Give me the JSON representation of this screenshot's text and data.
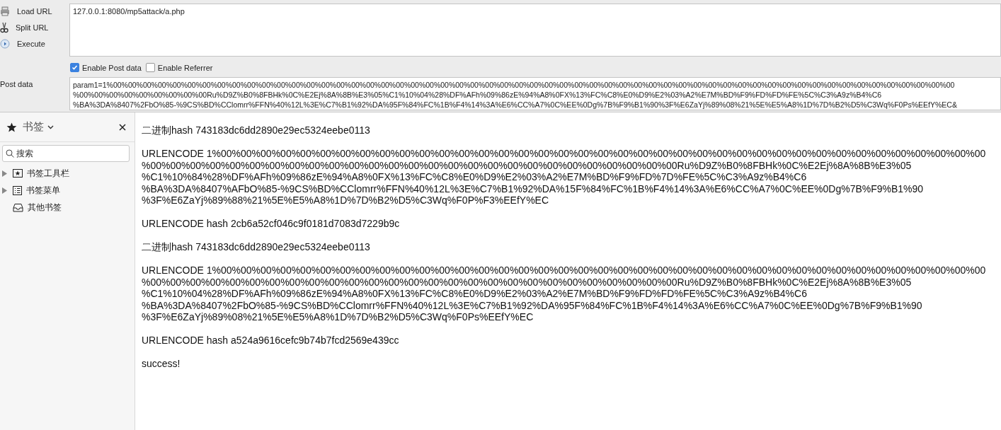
{
  "toolbar": {
    "buttons": [
      {
        "label": "Load URL",
        "kind": "load"
      },
      {
        "label": "Split URL",
        "kind": "split"
      },
      {
        "label": "Execute",
        "kind": "execute"
      }
    ],
    "url": "127.0.0.1:8080/mp5attack/a.php",
    "options": [
      {
        "label": "Enable Post data",
        "checked": true
      },
      {
        "label": "Enable Referrer",
        "checked": false
      }
    ],
    "post_data": {
      "label": "Post data",
      "lines": [
        "param1=1%00%00%00%00%00%00%00%00%00%00%00%00%00%00%00%00%00%00%00%00%00%00%00%00%00%00%00%00%00%00%00%00%00%00%00%00%00%00%00%00%00%00%00%00%00%00%00%00%00%00%00%00%00%00%00%00%00",
        "%00%00%00%00%00%00%00%00%00Ru%D9Z%B0%8FBHk%0C%E2Ej%8A%8B%E3%05%C1%10%04%28%DF%AFh%09%86zE%94%A8%0FX%13%FC%C8%E0%D9%E2%03%A2%E7M%BD%F9%FD%FD%FE%5C%C3%A9z%B4%C6",
        "%BA%3DA%8407%2FbO%85-%9CS%BD%CClomrr%FFN%40%12L%3E%C7%B1%92%DA%95F%84%FC%1B%F4%14%3A%E6%CC%A7%0C%EE%0Dg%7B%F9%B1%90%3F%E6ZaYj%89%08%21%5E%E5%A8%1D%7D%B2%D5%C3Wq%F0Ps%EEfY%EC&"
      ]
    }
  },
  "sidebar": {
    "title": "书签",
    "search": {
      "placeholder": "搜索"
    },
    "items": [
      {
        "label": "书签工具栏",
        "kind": "toolbar",
        "expandable": true
      },
      {
        "label": "书签菜单",
        "kind": "menu",
        "expandable": true
      },
      {
        "label": "其他书签",
        "kind": "other",
        "expandable": false
      }
    ]
  },
  "output": [
    {
      "kind": "text",
      "text": "二进制hash 743183dc6dd2890e29ec5324eebe0113"
    },
    {
      "kind": "block",
      "lines": [
        "URLENCODE 1%00%00%00%00%00%00%00%00%00%00%00%00%00%00%00%00%00%00%00%00%00%00%00%00%00%00%00%00%00%00%00%00%00%00%00%00%00%00%00",
        "%00%00%00%00%00%00%00%00%00%00%00%00%00%00%00%00%00%00%00%00%00%00%00%00%00%00%00Ru%D9Z%B0%8FBHk%0C%E2Ej%8A%8B%E3%05",
        "%C1%10%84%28%DF%AFh%09%86zE%94%A8%0FX%13%FC%C8%E0%D9%E2%03%A2%E7M%BD%F9%FD%7D%FE%5C%C3%A9z%B4%C6",
        "%BA%3DA%8407%AFbO%85-%9CS%BD%CClomrr%FFN%40%12L%3E%C7%B1%92%DA%15F%84%FC%1B%F4%14%3A%E6%CC%A7%0C%EE%0Dg%7B%F9%B1%90",
        "%3F%E6ZaYj%89%88%21%5E%E5%A8%1D%7D%B2%D5%C3Wq%F0P%F3%EEfY%EC"
      ]
    },
    {
      "kind": "text",
      "text": "URLENCODE hash 2cb6a52cf046c9f0181d7083d7229b9c"
    },
    {
      "kind": "text",
      "text": "二进制hash 743183dc6dd2890e29ec5324eebe0113"
    },
    {
      "kind": "block",
      "lines": [
        "URLENCODE 1%00%00%00%00%00%00%00%00%00%00%00%00%00%00%00%00%00%00%00%00%00%00%00%00%00%00%00%00%00%00%00%00%00%00%00%00%00%00%00",
        "%00%00%00%00%00%00%00%00%00%00%00%00%00%00%00%00%00%00%00%00%00%00%00%00%00%00%00Ru%D9Z%B0%8FBHk%0C%E2Ej%8A%8B%E3%05",
        "%C1%10%04%28%DF%AFh%09%86zE%94%A8%0FX%13%FC%C8%E0%D9%E2%03%A2%E7M%BD%F9%FD%FD%FE%5C%C3%A9z%B4%C6",
        "%BA%3DA%8407%2FbO%85-%9CS%BD%CClomrr%FFN%40%12L%3E%C7%B1%92%DA%95F%84%FC%1B%F4%14%3A%E6%CC%A7%0C%EE%0Dg%7B%F9%B1%90",
        "%3F%E6ZaYj%89%08%21%5E%E5%A8%1D%7D%B2%D5%C3Wq%F0Ps%EEfY%EC"
      ]
    },
    {
      "kind": "text",
      "text": "URLENCODE hash a524a9616cefc9b74b7fcd2569e439cc"
    },
    {
      "kind": "text",
      "text": "success!"
    }
  ]
}
